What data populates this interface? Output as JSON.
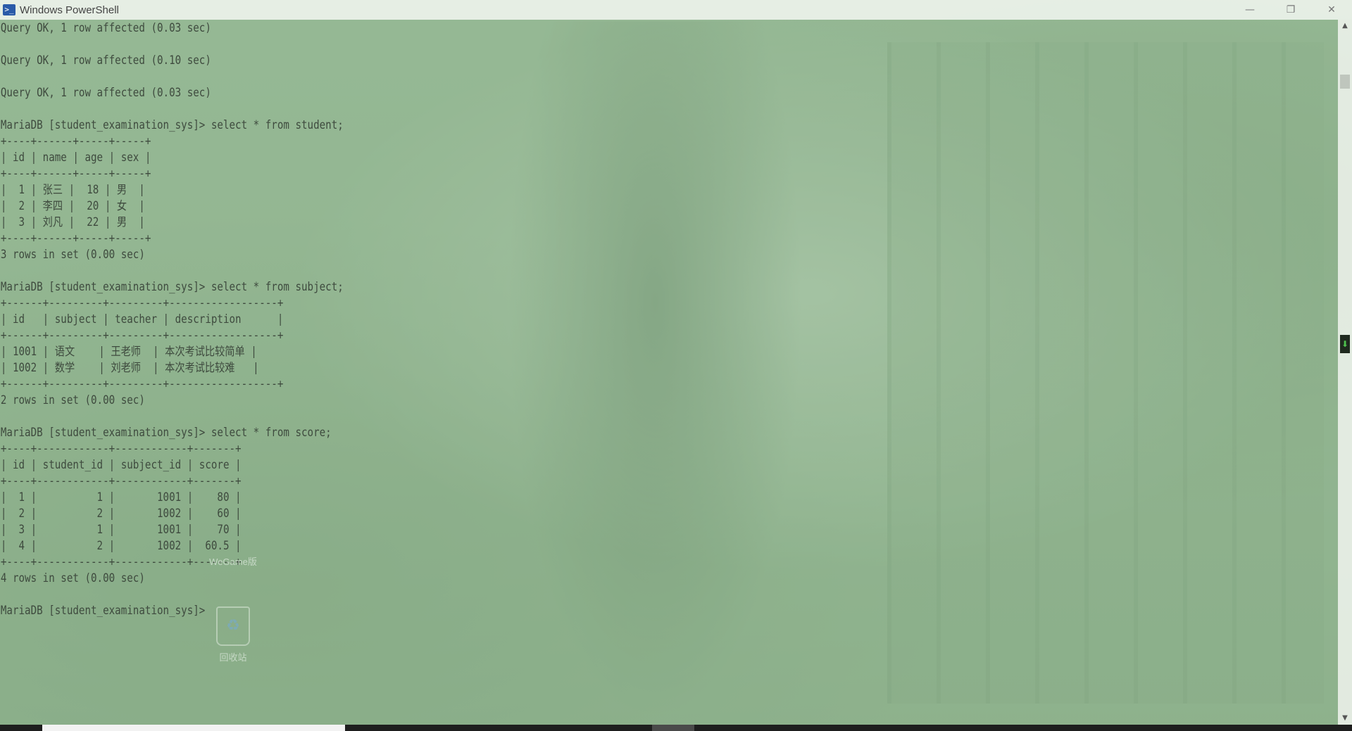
{
  "window": {
    "title": "Windows PowerShell",
    "icon": "powershell-icon",
    "controls": {
      "minimize": "—",
      "restore": "❐",
      "close": "✕"
    }
  },
  "console": {
    "lines": [
      "Query OK, 1 row affected (0.03 sec)",
      "",
      "Query OK, 1 row affected (0.10 sec)",
      "",
      "Query OK, 1 row affected (0.03 sec)",
      "",
      "MariaDB [student_examination_sys]> select * from student;",
      "+----+------+-----+-----+",
      "| id | name | age | sex |",
      "+----+------+-----+-----+",
      "|  1 | 张三 |  18 | 男  |",
      "|  2 | 李四 |  20 | 女  |",
      "|  3 | 刘凡 |  22 | 男  |",
      "+----+------+-----+-----+",
      "3 rows in set (0.00 sec)",
      "",
      "MariaDB [student_examination_sys]> select * from subject;",
      "+------+---------+---------+------------------+",
      "| id   | subject | teacher | description      |",
      "+------+---------+---------+------------------+",
      "| 1001 | 语文    | 王老师  | 本次考试比较简单 |",
      "| 1002 | 数学    | 刘老师  | 本次考试比较难   |",
      "+------+---------+---------+------------------+",
      "2 rows in set (0.00 sec)",
      "",
      "MariaDB [student_examination_sys]> select * from score;",
      "+----+------------+------------+-------+",
      "| id | student_id | subject_id | score |",
      "+----+------------+------------+-------+",
      "|  1 |          1 |       1001 |    80 |",
      "|  2 |          2 |       1002 |    60 |",
      "|  3 |          1 |       1001 |    70 |",
      "|  4 |          2 |       1002 |  60.5 |",
      "+----+------------+------------+-------+",
      "4 rows in set (0.00 sec)",
      "",
      "MariaDB [student_examination_sys]> "
    ]
  },
  "desktop_icons": {
    "wegame": "WeGame版",
    "recycle_bin": "回收站",
    "recycle_glyph": "♻"
  },
  "scrollbar": {
    "up_arrow": "▲",
    "down_arrow": "▼",
    "marker_glyph": "⬇"
  }
}
